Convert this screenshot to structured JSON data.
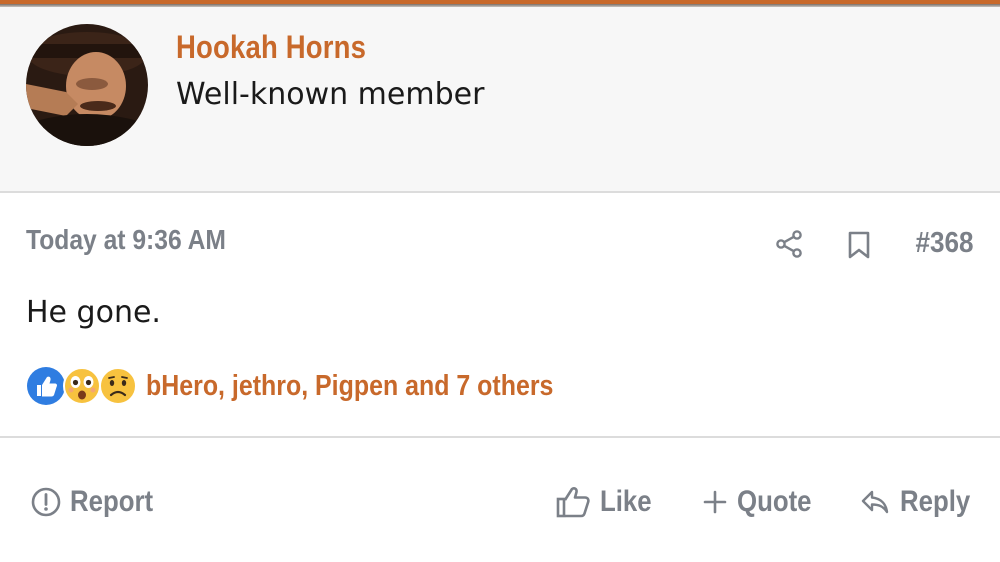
{
  "user": {
    "name": "Hookah Horns",
    "title": "Well-known member"
  },
  "post": {
    "timestamp": "Today at 9:36 AM",
    "number": "#368",
    "body": "He gone.",
    "reactions": {
      "icons": [
        "like-reaction-icon",
        "wow-reaction-icon",
        "sad-reaction-icon"
      ],
      "users_text": "bHero, jethro, Pigpen and 7 others"
    }
  },
  "actions": {
    "report": "Report",
    "like": "Like",
    "quote": "Quote",
    "reply": "Reply"
  },
  "colors": {
    "accent": "#c8692b",
    "muted": "#7b8088",
    "text": "#1a1a1a",
    "like_blue": "#2f7de1"
  }
}
